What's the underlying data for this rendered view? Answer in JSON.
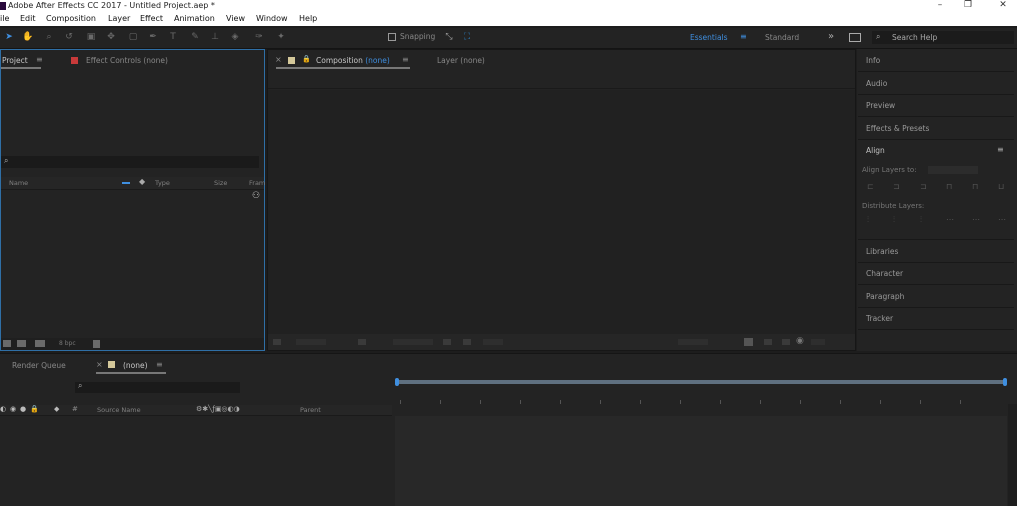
{
  "titlebar": {
    "title": "Adobe After Effects CC 2017 - Untitled Project.aep *",
    "minimize": "–",
    "restore": "❐",
    "close": "✕"
  },
  "menu": [
    "ile",
    "Edit",
    "Composition",
    "Layer",
    "Effect",
    "Animation",
    "View",
    "Window",
    "Help"
  ],
  "toolbar": {
    "snapping_label": "Snapping",
    "workspace_essentials": "Essentials",
    "workspace_standard": "Standard",
    "more_glyph": "»",
    "search_placeholder": "Search Help"
  },
  "project_panel": {
    "tab_project": "Project",
    "tab_effect_controls": "Effect Controls (none)",
    "columns": [
      "Name",
      "Type",
      "Size",
      "Fram"
    ],
    "bpc": "8 bpc"
  },
  "comp_panel": {
    "tab_composition": "Composition",
    "tab_composition_value": "(none)",
    "tab_layer": "Layer (none)"
  },
  "right_panels": {
    "items": [
      "Info",
      "Audio",
      "Preview",
      "Effects & Presets",
      "Align"
    ],
    "align_layers_to": "Align Layers to:",
    "distribute_layers": "Distribute Layers:",
    "bottom_items": [
      "Libraries",
      "Character",
      "Paragraph",
      "Tracker"
    ]
  },
  "timeline": {
    "tab_render_queue": "Render Queue",
    "tab_none": "(none)",
    "col_source_name": "Source Name",
    "col_parent": "Parent"
  },
  "colors": {
    "accent": "#3f8fe0",
    "effect_controls_swatch": "#c83a3a",
    "comp_swatch": "#d4c89a"
  }
}
